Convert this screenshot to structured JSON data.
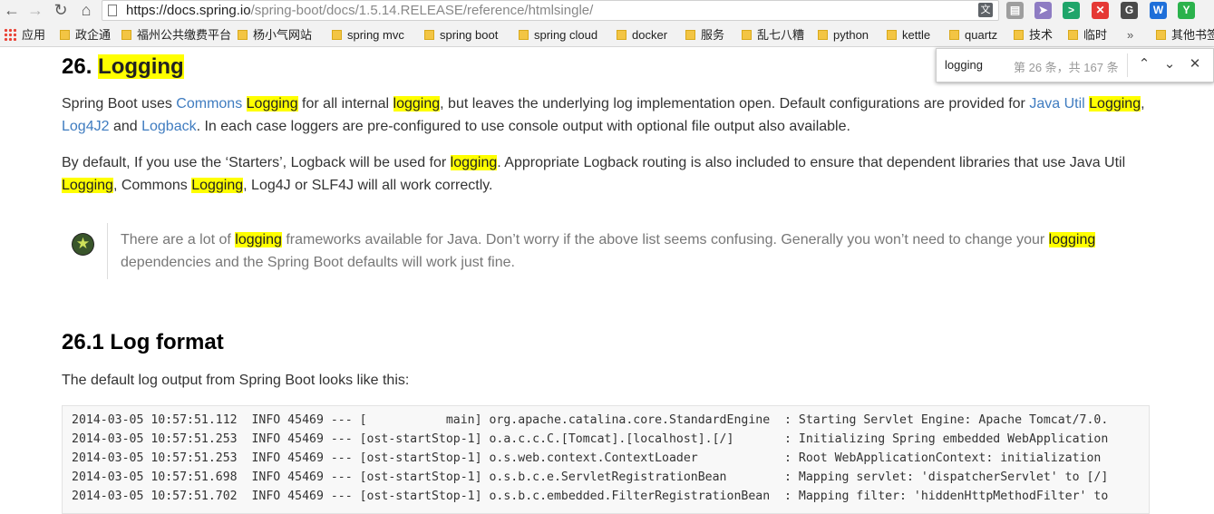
{
  "browser": {
    "url_host": "https://docs.spring.io",
    "url_path": "/spring-boot/docs/1.5.14.RELEASE/reference/htmlsingle/",
    "nav": {
      "back": "←",
      "forward": "→",
      "reload": "↻",
      "home": "⌂"
    },
    "extensions": [
      {
        "name": "ext-doc-icon",
        "glyph": "▤",
        "color": "#9e9e9e"
      },
      {
        "name": "ext-cursor-icon",
        "glyph": "➤",
        "color": "#8e7cc3"
      },
      {
        "name": "ext-terminal-icon",
        "glyph": ">",
        "color": "#1fa56a"
      },
      {
        "name": "ext-block-icon",
        "glyph": "✕",
        "color": "#e53935"
      },
      {
        "name": "ext-g-icon",
        "glyph": "G",
        "color": "#4a4a4a"
      },
      {
        "name": "ext-w-icon",
        "glyph": "W",
        "color": "#1e6fd9"
      },
      {
        "name": "ext-y-icon",
        "glyph": "Y",
        "color": "#2bb24c"
      }
    ]
  },
  "bookmarks": {
    "apps_label": "应用",
    "items": [
      "政企通",
      "福州公共缴费平台",
      "杨小气网站",
      "spring mvc",
      "spring boot",
      "spring cloud",
      "docker",
      "服务",
      "乱七八糟",
      "python",
      "kettle",
      "quartz",
      "技术",
      "临时"
    ],
    "overflow": "»",
    "other": "其他书签"
  },
  "find": {
    "query": "logging",
    "count": "第 26 条，共 167 条",
    "prev": "⌃",
    "next": "⌄",
    "close": "✕"
  },
  "section": {
    "number": "26.",
    "title": "Logging",
    "p1": {
      "t1": "Spring Boot uses ",
      "l1": "Commons",
      "h1": "Logging",
      "t2": " for all internal ",
      "h2": "logging",
      "t3": ", but leaves the underlying log implementation open. Default configurations are provided for ",
      "l2": "Java Util",
      "h3": "Logging",
      "t4": ",",
      "l3": "Log4J2",
      "t5": " and ",
      "l4": "Logback",
      "t6": ". In each case loggers are pre-configured to use console output with optional file output also available."
    },
    "p2": {
      "t1": "By default, If you use the ‘Starters’, Logback will be used for ",
      "h1": "logging",
      "t2": ". Appropriate Logback routing is also included to ensure that dependent libraries that use Java Util",
      "h2": "Logging",
      "t3": ", Commons ",
      "h3": "Logging",
      "t4": ", Log4J or SLF4J will all work correctly."
    },
    "tip": {
      "t1": "There are a lot of ",
      "h1": "logging",
      "t2": " frameworks available for Java. Don’t worry if the above list seems confusing. Generally you won’t need to change your ",
      "h2": "logging",
      "t3": "dependencies and the Spring Boot defaults will work just fine."
    }
  },
  "subsection": {
    "title": "26.1 Log format",
    "intro": "The default log output from Spring Boot looks like this:",
    "code_lines": [
      "2014-03-05 10:57:51.112  INFO 45469 --- [           main] org.apache.catalina.core.StandardEngine  : Starting Servlet Engine: Apache Tomcat/7.0.",
      "2014-03-05 10:57:51.253  INFO 45469 --- [ost-startStop-1] o.a.c.c.C.[Tomcat].[localhost].[/]       : Initializing Spring embedded WebApplication",
      "2014-03-05 10:57:51.253  INFO 45469 --- [ost-startStop-1] o.s.web.context.ContextLoader            : Root WebApplicationContext: initialization",
      "2014-03-05 10:57:51.698  INFO 45469 --- [ost-startStop-1] o.s.b.c.e.ServletRegistrationBean        : Mapping servlet: 'dispatcherServlet' to [/]",
      "2014-03-05 10:57:51.702  INFO 45469 --- [ost-startStop-1] o.s.b.c.embedded.FilterRegistrationBean  : Mapping filter: 'hiddenHttpMethodFilter' to"
    ]
  }
}
